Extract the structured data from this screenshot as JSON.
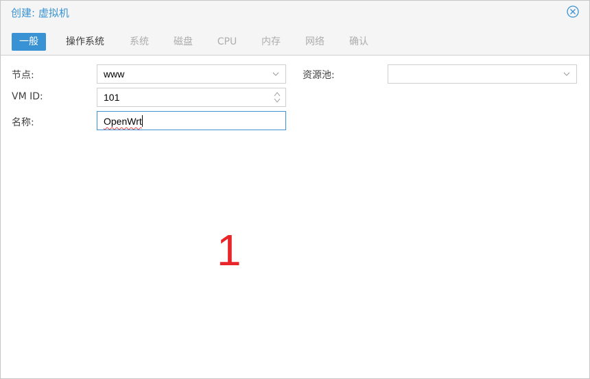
{
  "dialog": {
    "title": "创建: 虚拟机"
  },
  "tabs": [
    {
      "label": "一般",
      "state": "active"
    },
    {
      "label": "操作系统",
      "state": "enabled"
    },
    {
      "label": "系统",
      "state": "disabled"
    },
    {
      "label": "磁盘",
      "state": "disabled"
    },
    {
      "label": "CPU",
      "state": "disabled"
    },
    {
      "label": "内存",
      "state": "disabled"
    },
    {
      "label": "网络",
      "state": "disabled"
    },
    {
      "label": "确认",
      "state": "disabled"
    }
  ],
  "form": {
    "node": {
      "label": "节点:",
      "value": "www"
    },
    "vmid": {
      "label": "VM ID:",
      "value": "101"
    },
    "name": {
      "label": "名称:",
      "value": "OpenWrt"
    },
    "pool": {
      "label": "资源池:",
      "value": ""
    }
  },
  "annotation": {
    "text": "1",
    "color": "#e8262a"
  },
  "colors": {
    "accent": "#3892d3",
    "disabled_text": "#adadad"
  }
}
